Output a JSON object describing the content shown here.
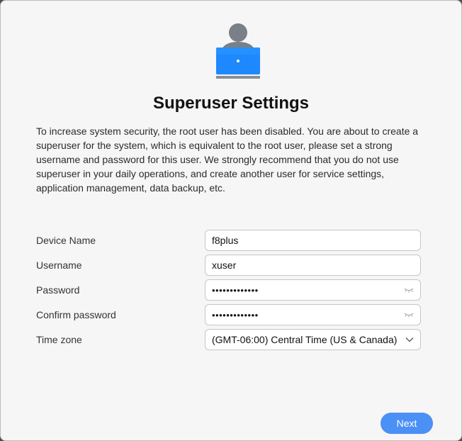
{
  "dialog": {
    "title": "Superuser Settings",
    "description": "To increase system security, the root user has been disabled. You are about to create a superuser for the system, which is equivalent to the root user, please set a strong username and password for this user. We strongly recommend that you do not use superuser in your daily operations, and create another user for service settings, application management, data backup, etc."
  },
  "form": {
    "device_name": {
      "label": "Device Name",
      "value": "f8plus"
    },
    "username": {
      "label": "Username",
      "value": "xuser"
    },
    "password": {
      "label": "Password",
      "value": "•••••••••••••"
    },
    "confirm_password": {
      "label": "Confirm password",
      "value": "•••••••••••••"
    },
    "time_zone": {
      "label": "Time zone",
      "value": "(GMT-06:00) Central Time (US & Canada)"
    }
  },
  "actions": {
    "next_label": "Next"
  },
  "icons": {
    "hero": "user-laptop-icon",
    "password_toggle": "eye-closed-icon",
    "dropdown": "chevron-down-icon"
  },
  "colors": {
    "accent": "#4a90f5",
    "laptop": "#1e90ff",
    "avatar": "#7a8087"
  }
}
